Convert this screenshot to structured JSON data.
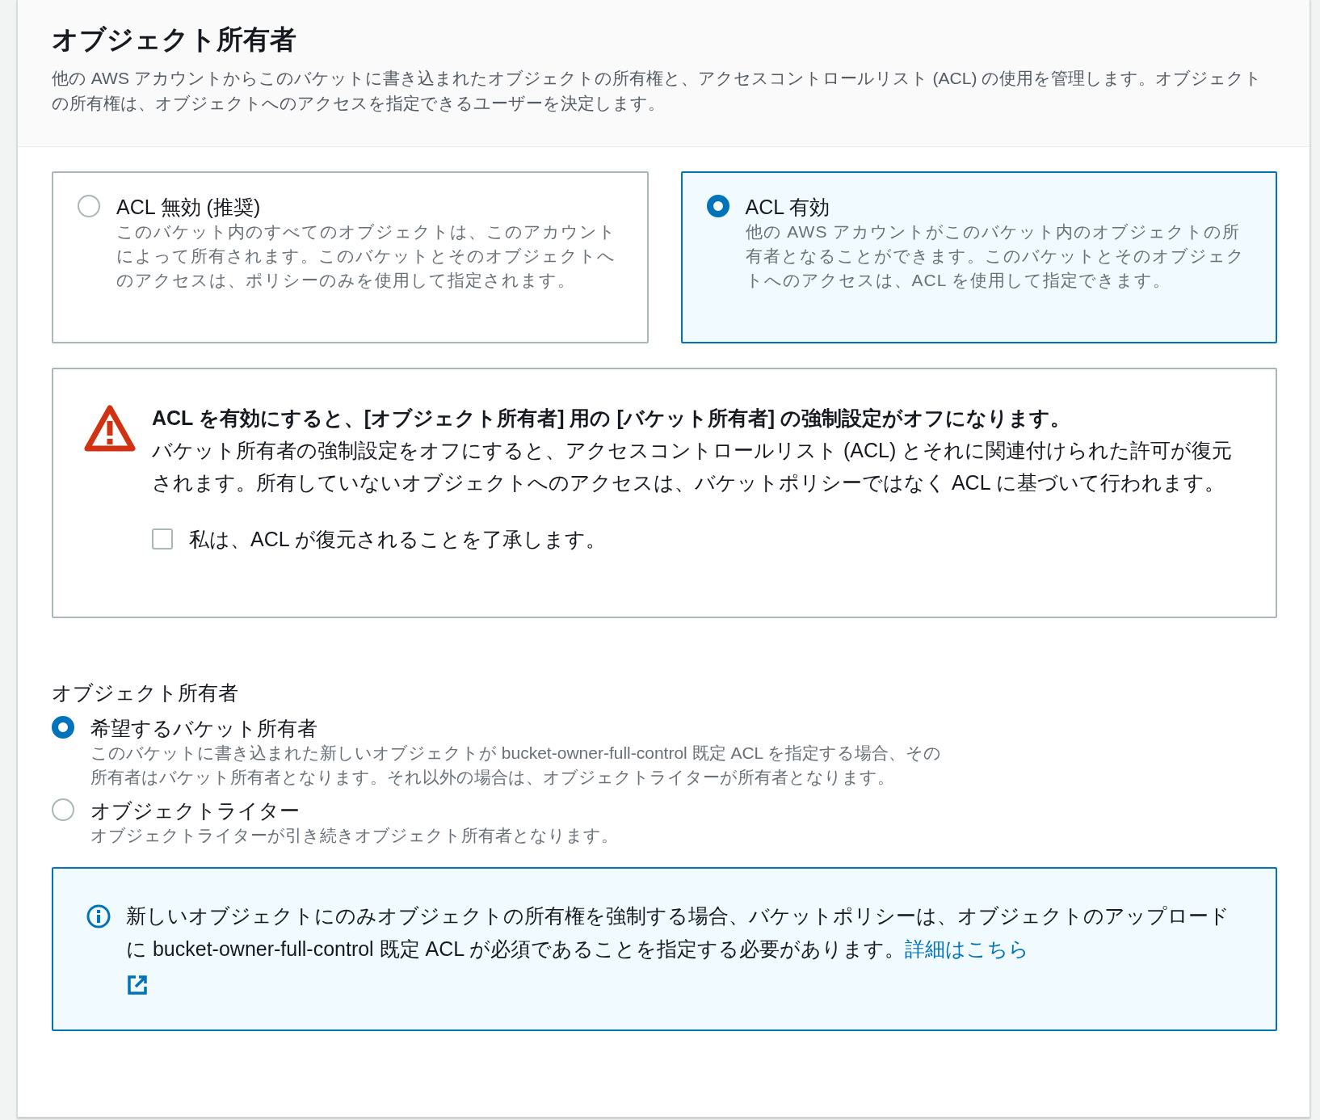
{
  "header": {
    "title": "オブジェクト所有者",
    "description": "他の AWS アカウントからこのバケットに書き込まれたオブジェクトの所有権と、アクセスコントロールリスト (ACL) の使用を管理します。オブジェクトの所有権は、オブジェクトへのアクセスを指定できるユーザーを決定します。"
  },
  "acl_options": [
    {
      "label": "ACL 無効 (推奨)",
      "description": "このバケット内のすべてのオブジェクトは、このアカウントによって所有されます。このバケットとそのオブジェクトへのアクセスは、ポリシーのみを使用して指定されます。",
      "selected": false
    },
    {
      "label": "ACL 有効",
      "description": "他の AWS アカウントがこのバケット内のオブジェクトの所有者となることができます。このバケットとそのオブジェクトへのアクセスは、ACL を使用して指定できます。",
      "selected": true
    }
  ],
  "warning": {
    "title": "ACL を有効にすると、[オブジェクト所有者] 用の [バケット所有者] の強制設定がオフになります。",
    "body": "バケット所有者の強制設定をオフにすると、アクセスコントロールリスト (ACL) とそれに関連付けられた許可が復元されます。所有していないオブジェクトへのアクセスは、バケットポリシーではなく ACL に基づいて行われます。",
    "acknowledge": {
      "label": "私は、ACL が復元されることを了承します。",
      "checked": false
    }
  },
  "ownership": {
    "label": "オブジェクト所有者",
    "options": [
      {
        "label": "希望するバケット所有者",
        "description": "このバケットに書き込まれた新しいオブジェクトが bucket-owner-full-control 既定 ACL を指定する場合、その所有者はバケット所有者となります。それ以外の場合は、オブジェクトライターが所有者となります。",
        "selected": true
      },
      {
        "label": "オブジェクトライター",
        "description": "オブジェクトライターが引き続きオブジェクト所有者となります。",
        "selected": false
      }
    ]
  },
  "info": {
    "text": "新しいオブジェクトにのみオブジェクトの所有権を強制する場合、バケットポリシーは、オブジェクトのアップロードに bucket-owner-full-control 既定 ACL が必須であることを指定する必要があります。",
    "link": "詳細はこちら"
  }
}
